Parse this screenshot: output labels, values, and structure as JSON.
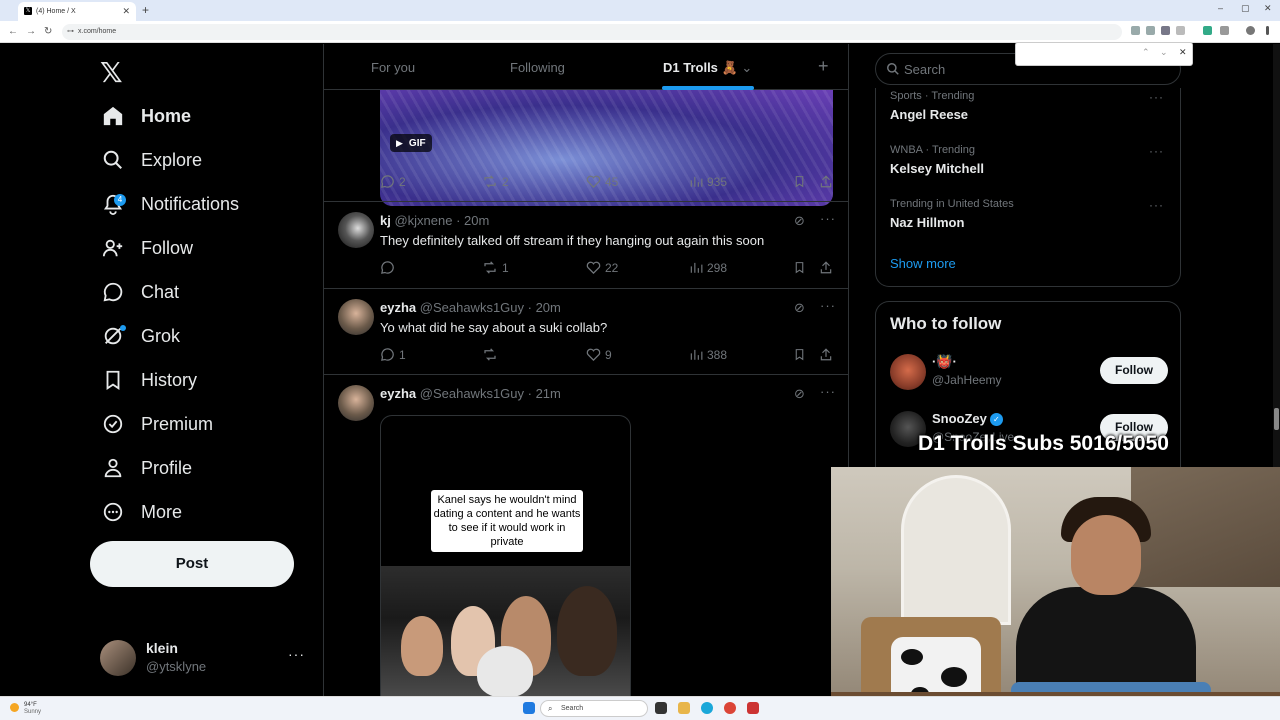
{
  "browser": {
    "tab_title": "(4) Home / X",
    "url": "x.com/home"
  },
  "sidebar": {
    "items": [
      {
        "label": "Home",
        "icon": "home-icon"
      },
      {
        "label": "Explore",
        "icon": "search-icon"
      },
      {
        "label": "Notifications",
        "icon": "bell-icon",
        "badge": "4"
      },
      {
        "label": "Follow",
        "icon": "add-person-icon"
      },
      {
        "label": "Chat",
        "icon": "chat-icon"
      },
      {
        "label": "Grok",
        "icon": "grok-icon"
      },
      {
        "label": "History",
        "icon": "bookmark-icon"
      },
      {
        "label": "Premium",
        "icon": "verified-icon"
      },
      {
        "label": "Profile",
        "icon": "person-icon"
      },
      {
        "label": "More",
        "icon": "more-circle-icon"
      }
    ],
    "post_label": "Post",
    "account": {
      "name": "klein",
      "handle": "@ytsklyne"
    }
  },
  "feed": {
    "tabs": [
      "For you",
      "Following",
      "D1 Trolls"
    ],
    "gif_label": "GIF",
    "first_actions": {
      "replies": "2",
      "reposts": "2",
      "likes": "45",
      "views": "935"
    },
    "tweets": [
      {
        "name": "kj",
        "handle": "@kjxnene",
        "time": "20m",
        "text": "They definitely talked off stream if they hanging out again this soon",
        "replies": "",
        "reposts": "1",
        "likes": "22",
        "views": "298"
      },
      {
        "name": "eyzha",
        "handle": "@Seahawks1Guy",
        "time": "20m",
        "text": "Yo what did he say about a suki collab?",
        "replies": "1",
        "reposts": "",
        "likes": "9",
        "views": "388"
      },
      {
        "name": "eyzha",
        "handle": "@Seahawks1Guy",
        "time": "21m",
        "text": "",
        "caption": "Kanel says he wouldn't mind dating a content and he wants to see if it would work in private"
      }
    ]
  },
  "right": {
    "search_placeholder": "Search",
    "trends": [
      {
        "meta": "Sports · Trending",
        "name": "Angel Reese"
      },
      {
        "meta": "WNBA · Trending",
        "name": "Kelsey Mitchell"
      },
      {
        "meta": "Trending in United States",
        "name": "Naz Hillmon"
      }
    ],
    "show_more": "Show more",
    "who_to_follow_title": "Who to follow",
    "follow_suggestions": [
      {
        "name": "·👹·",
        "handle": "@JahHeemy",
        "button": "Follow"
      },
      {
        "name": "SnooZey",
        "handle": "@SnooZeyLive",
        "button": "Follow"
      }
    ]
  },
  "overlay": {
    "subs_text": "D1 Trolls Subs 5016/5050"
  },
  "taskbar": {
    "weather_temp": "94°F",
    "weather_desc": "Sunny",
    "search_label": "Search"
  },
  "colors": {
    "accent": "#1d9bf0",
    "background": "#000000",
    "border": "#2f3336",
    "muted": "#71767b"
  }
}
